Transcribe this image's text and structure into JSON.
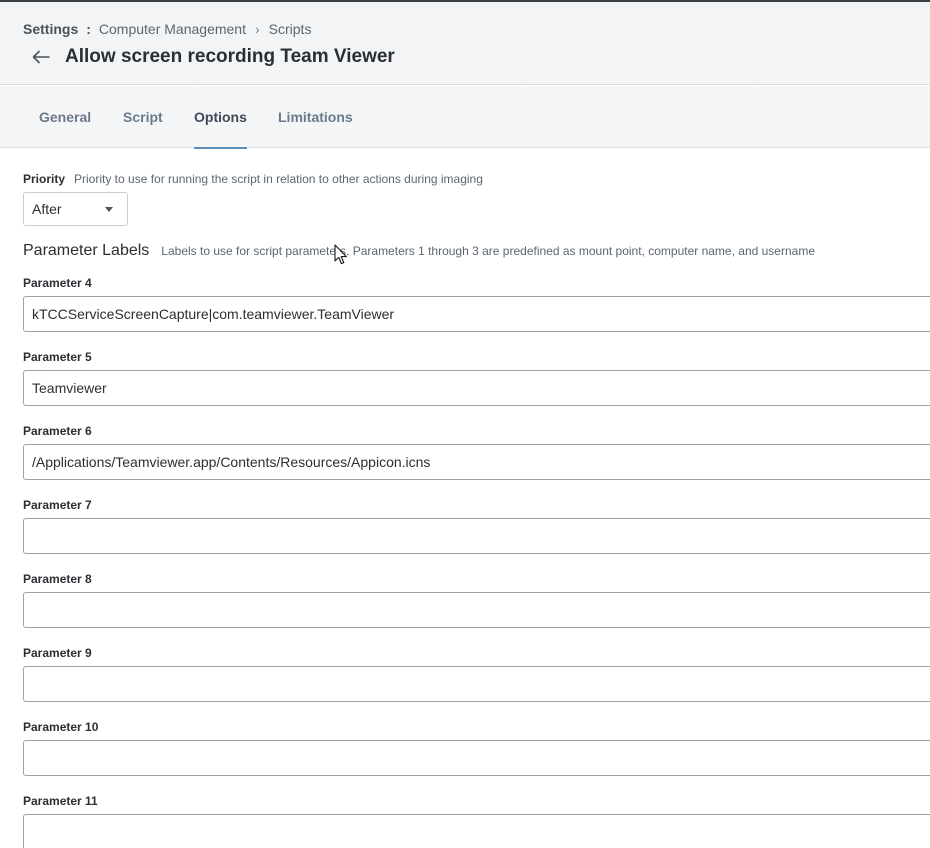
{
  "breadcrumb": {
    "root": "Settings",
    "separator_colon": ":",
    "section": "Computer Management",
    "separator_chevron": "›",
    "current": "Scripts"
  },
  "page": {
    "back_icon": "arrow-left-icon",
    "title": "Allow screen recording Team Viewer"
  },
  "tabs": [
    {
      "label": "General",
      "active": false
    },
    {
      "label": "Script",
      "active": false
    },
    {
      "label": "Options",
      "active": true
    },
    {
      "label": "Limitations",
      "active": false
    }
  ],
  "priority": {
    "label": "Priority",
    "description": "Priority to use for running the script in relation to other actions during imaging",
    "value": "After",
    "icon": "caret-down-icon"
  },
  "parameter_labels": {
    "title": "Parameter Labels",
    "description": "Labels to use for script parameters. Parameters 1 through 3 are predefined as mount point, computer name, and username"
  },
  "parameters": [
    {
      "label": "Parameter 4",
      "value": "kTCCServiceScreenCapture|com.teamviewer.TeamViewer"
    },
    {
      "label": "Parameter 5",
      "value": "Teamviewer"
    },
    {
      "label": "Parameter 6",
      "value": "/Applications/Teamviewer.app/Contents/Resources/Appicon.icns"
    },
    {
      "label": "Parameter 7",
      "value": ""
    },
    {
      "label": "Parameter 8",
      "value": ""
    },
    {
      "label": "Parameter 9",
      "value": ""
    },
    {
      "label": "Parameter 10",
      "value": ""
    },
    {
      "label": "Parameter 11",
      "value": ""
    }
  ],
  "colors": {
    "header_bg": "#f3f4f6",
    "active_tab_underline": "#5b8fb9",
    "tab_text": "#6b7a8a"
  }
}
